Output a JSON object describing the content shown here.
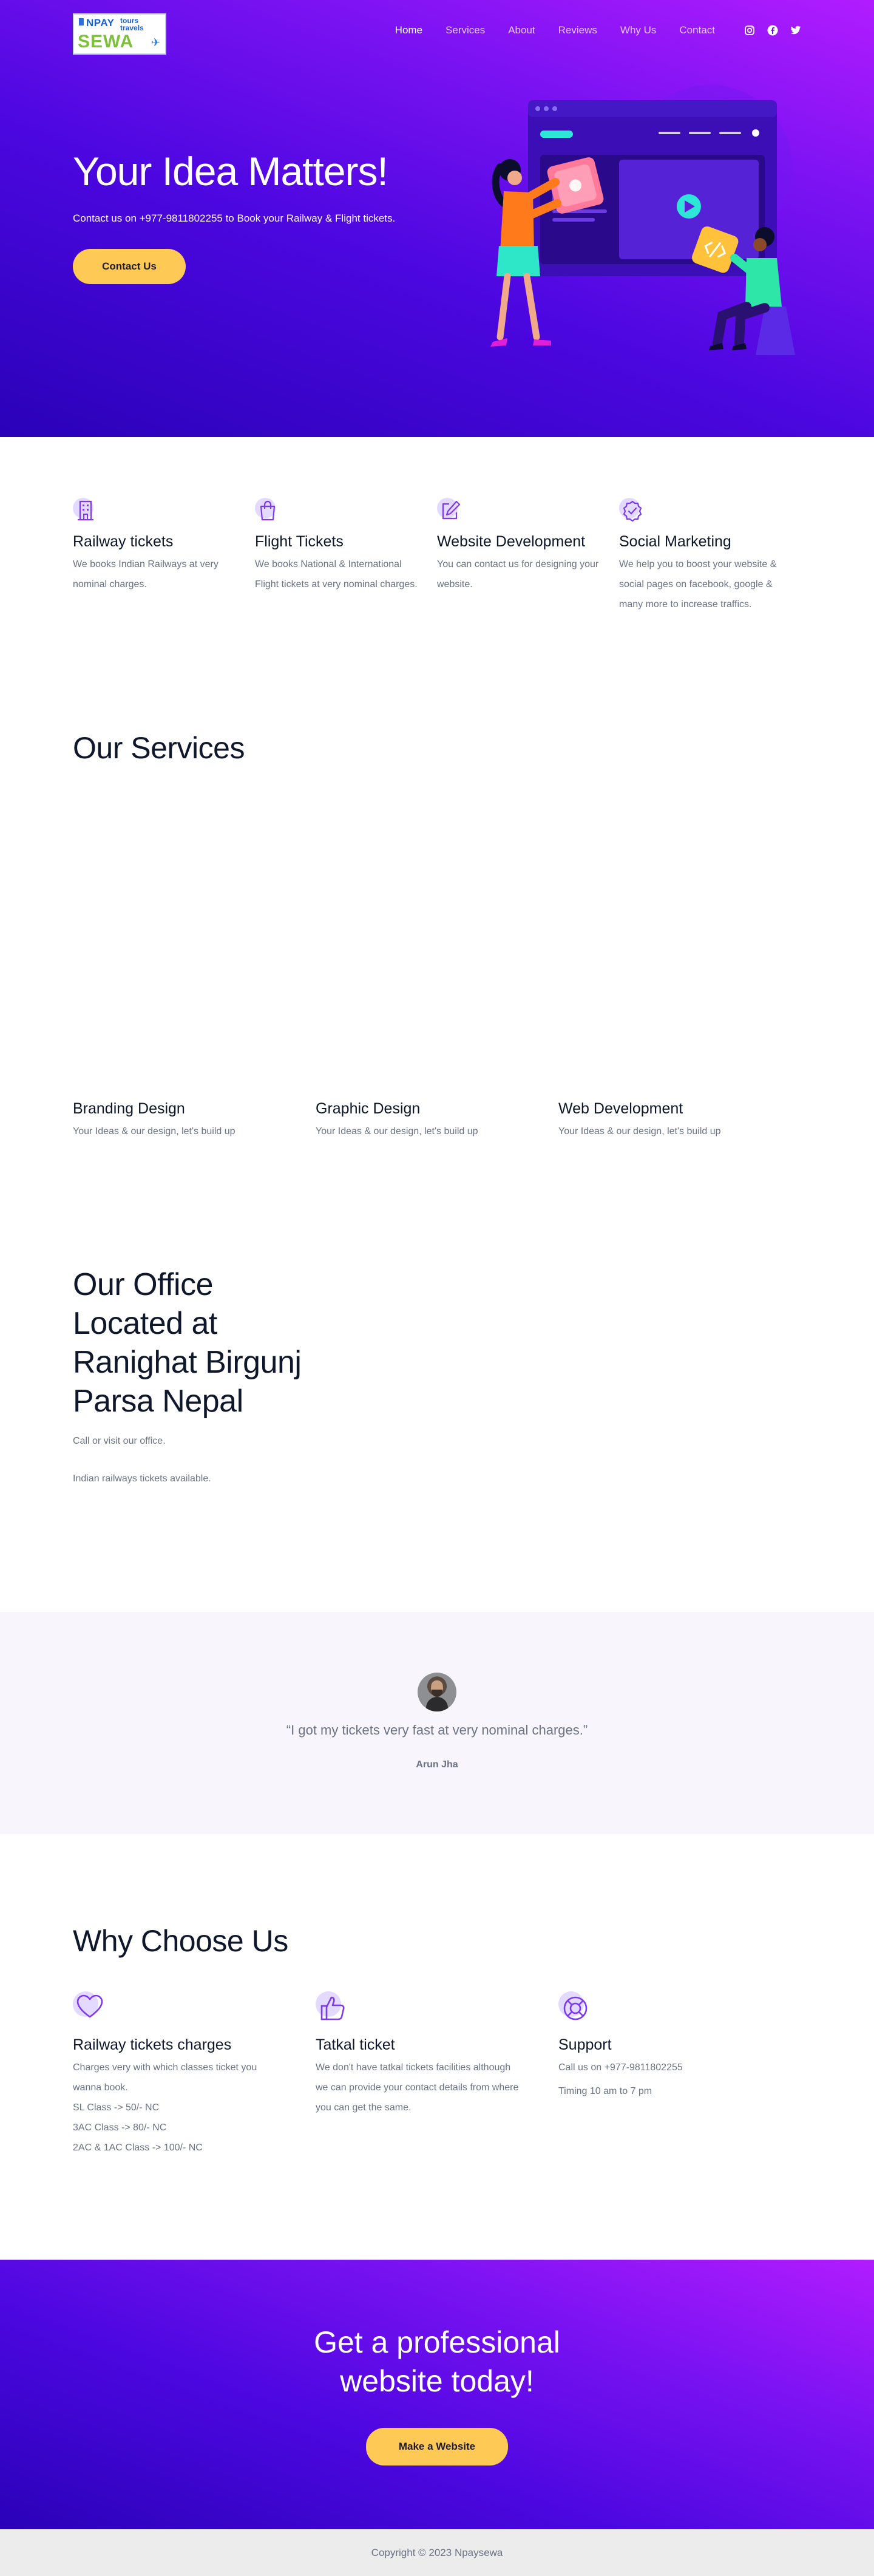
{
  "brand": {
    "logo_text_top": "NPAY",
    "logo_text_bottom": "SEWA",
    "logo_tagline": "tours travels"
  },
  "nav": {
    "items": [
      "Home",
      "Services",
      "About",
      "Reviews",
      "Why Us",
      "Contact"
    ],
    "active": "Home",
    "social_icons": [
      "instagram-icon",
      "facebook-icon",
      "twitter-icon"
    ]
  },
  "hero": {
    "title": "Your Idea Matters!",
    "subtitle": "Contact us on +977-9811802255 to Book your Railway & Flight tickets.",
    "button": "Contact Us"
  },
  "features": [
    {
      "icon": "building-icon",
      "title": "Railway tickets",
      "text": "We books Indian Railways at very nominal charges."
    },
    {
      "icon": "shopping-bag-icon",
      "title": "Flight Tickets",
      "text": "We books National & International Flight tickets at very nominal charges."
    },
    {
      "icon": "edit-icon",
      "title": "Website Development",
      "text": "You can contact us for designing your website."
    },
    {
      "icon": "verified-badge-icon",
      "title": "Social Marketing",
      "text": "We help you to boost your website & social pages on facebook, google & many more to increase traffics."
    }
  ],
  "services": {
    "title": "Our Services",
    "items": [
      {
        "title": "Branding Design",
        "text": "Your Ideas & our design, let's build up"
      },
      {
        "title": "Graphic Design",
        "text": "Your Ideas & our design, let's build up"
      },
      {
        "title": "Web Development",
        "text": "Your Ideas & our design, let's build up"
      }
    ]
  },
  "office": {
    "title": "Our Office Located at Ranighat Birgunj Parsa Nepal",
    "line1": "Call or visit our office.",
    "line2": "Indian railways tickets available."
  },
  "testimonial": {
    "quote": "“I got my tickets very fast at very nominal charges.”",
    "author": "Arun Jha"
  },
  "why": {
    "title": "Why Choose Us",
    "items": [
      {
        "icon": "heart-icon",
        "title": "Railway tickets charges",
        "text": "Charges very with which classes ticket you wanna book.",
        "lines": [
          "SL Class -> 50/- NC",
          "3AC Class -> 80/- NC",
          "2AC & 1AC Class -> 100/- NC"
        ]
      },
      {
        "icon": "thumbs-up-icon",
        "title": "Tatkal ticket",
        "text": "We don't have tatkal tickets facilities although we can provide your contact details from where you can get the same.",
        "lines": []
      },
      {
        "icon": "lifebuoy-icon",
        "title": "Support",
        "text": "Call us on +977-9811802255",
        "lines": [
          "Timing 10 am to 7 pm"
        ]
      }
    ]
  },
  "cta": {
    "title": "Get a professional website today!",
    "button": "Make a Website"
  },
  "footer": {
    "copyright": "Copyright © 2023 Npaysewa"
  },
  "colors": {
    "accent": "#ffc955",
    "gradient_start": "#b11cff",
    "gradient_end": "#2a02b8",
    "icon_purple": "#7c3aed"
  }
}
